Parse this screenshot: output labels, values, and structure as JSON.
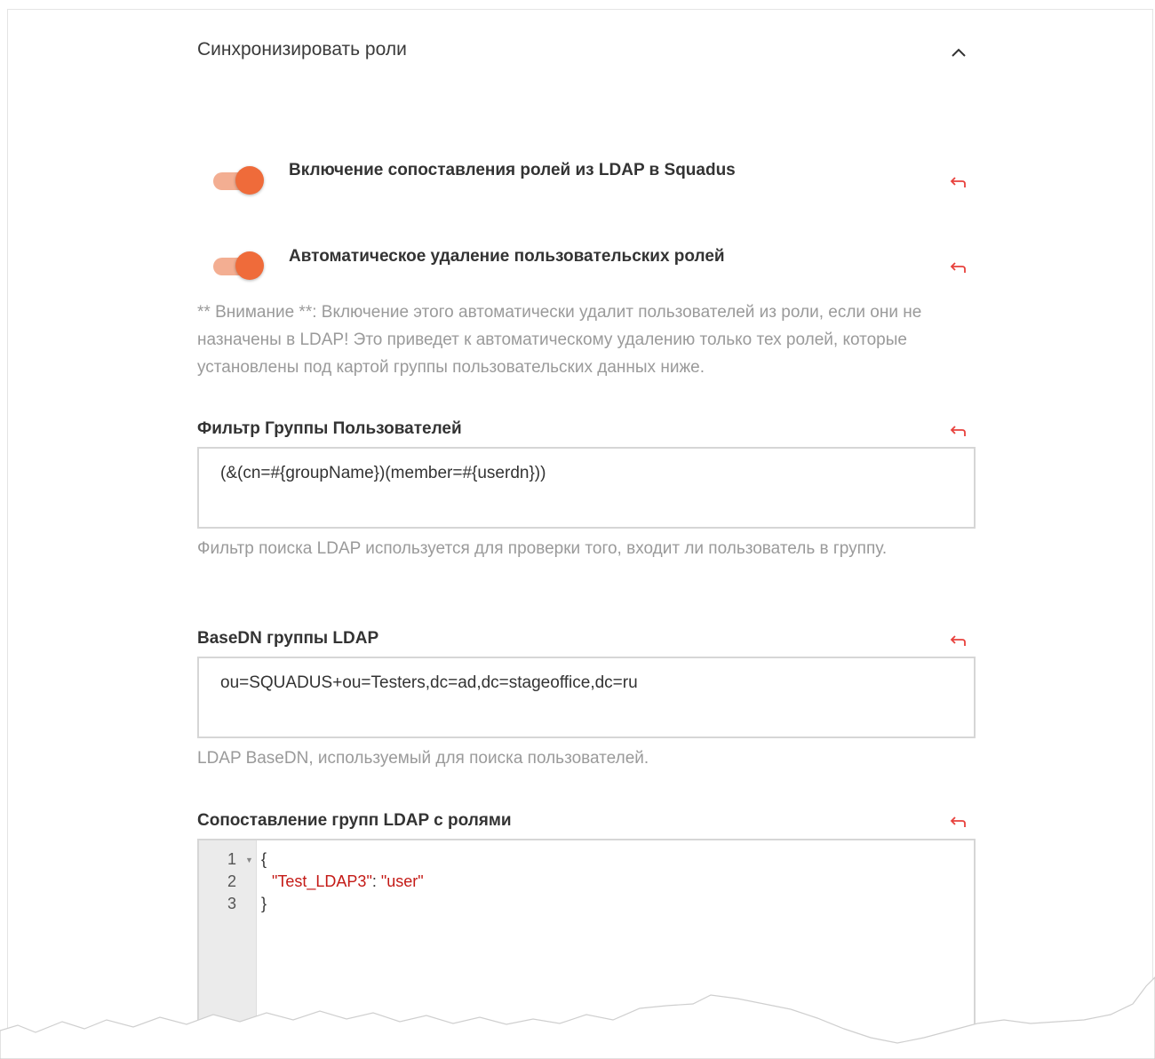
{
  "section": {
    "title": "Синхронизировать роли",
    "expanded": true
  },
  "toggles": [
    {
      "label": "Включение сопоставления ролей из LDAP в Squadus",
      "enabled": true
    },
    {
      "label": "Автоматическое удаление пользовательских ролей",
      "enabled": true
    }
  ],
  "warning": "** Внимание **: Включение этого автоматически удалит пользователей из роли, если они не назначены в LDAP! Это приведет к автоматическому удалению только тех ролей, которые установлены под картой группы пользовательских данных ниже.",
  "group_filter": {
    "label": "Фильтр Группы Пользователей",
    "value": "(&(cn=#{groupName})(member=#{userdn}))",
    "help": "Фильтр поиска LDAP используется для проверки того, входит ли пользователь в группу."
  },
  "group_basedn": {
    "label": "BaseDN группы LDAP",
    "value": "ou=SQUADUS+ou=Testers,dc=ad,dc=stageoffice,dc=ru",
    "help": "LDAP BaseDN, используемый для поиска пользователей."
  },
  "role_mapping": {
    "label": "Сопоставление групп LDAP с ролями",
    "line_numbers": [
      "1",
      "2",
      "3"
    ],
    "lines": {
      "open": "{",
      "key": "\"Test_LDAP3\"",
      "sep": ": ",
      "value": "\"user\"",
      "close": "}"
    }
  },
  "colors": {
    "accent": "#ef6b3a",
    "reset_icon": "#e8413c"
  },
  "icons": {
    "collapse": "chevron-up-icon",
    "reset": "reset-arrow-icon"
  }
}
